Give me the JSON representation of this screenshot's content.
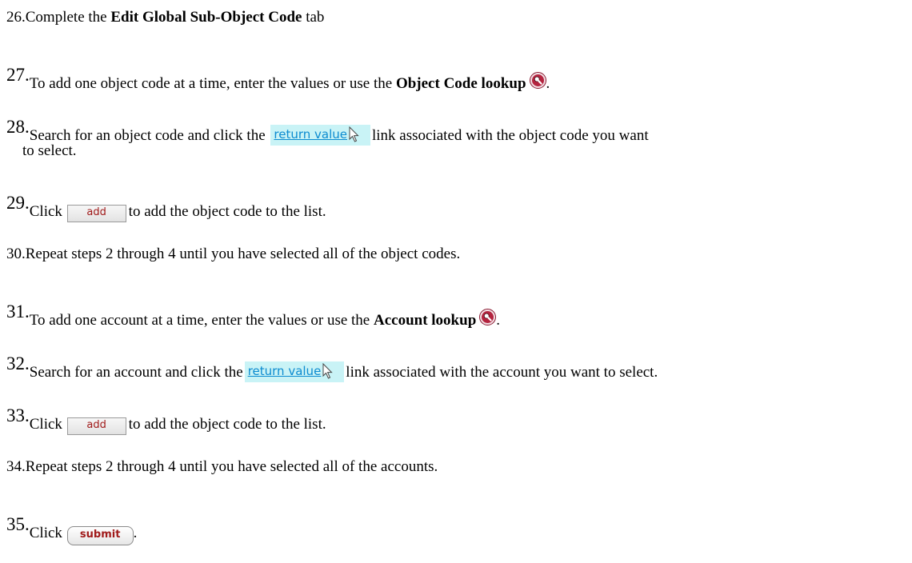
{
  "steps": {
    "s26": {
      "num": "26.",
      "text_before": "Complete the ",
      "bold": "Edit Global Sub-Object Code",
      "text_after": " tab"
    },
    "s27": {
      "num": "27.",
      "text_before": "To add one object code at a time, enter the values or use the ",
      "bold": "Object Code lookup",
      "text_after": "."
    },
    "s28": {
      "num": "28.",
      "text_before": "Search for an object code and click the ",
      "link": "return value",
      "text_after": "link associated with the object code you want",
      "continuation": "to select."
    },
    "s29": {
      "num": "29.",
      "text_before": "Click ",
      "button": "add",
      "text_after": "to add the object code to the list."
    },
    "s30": {
      "num": "30.",
      "text": "Repeat steps 2 through 4 until you have selected all of the object codes."
    },
    "s31": {
      "num": "31.",
      "text_before": "To add one account at a time, enter the values or use the ",
      "bold": "Account lookup",
      "text_after": "."
    },
    "s32": {
      "num": "32.",
      "text_before": "Search for an account and click the",
      "link": "return value",
      "text_after": "link associated with the account you want to select."
    },
    "s33": {
      "num": "33.",
      "text_before": "Click ",
      "button": "add",
      "text_after": "to add the object code to the list."
    },
    "s34": {
      "num": "34.",
      "text": "Repeat steps 2 through 4 until you have selected all of the accounts."
    },
    "s35": {
      "num": "35.",
      "text_before": "Click ",
      "button": "submit",
      "text_after": "."
    }
  },
  "colors": {
    "link_text": "#0c8bd0",
    "link_background": "#c9f3f6",
    "button_text": "#a01a1a",
    "lookup_icon": "#a8203a"
  },
  "icons": {
    "lookup": "magnifying-glass-icon",
    "cursor": "mouse-pointer-icon"
  }
}
